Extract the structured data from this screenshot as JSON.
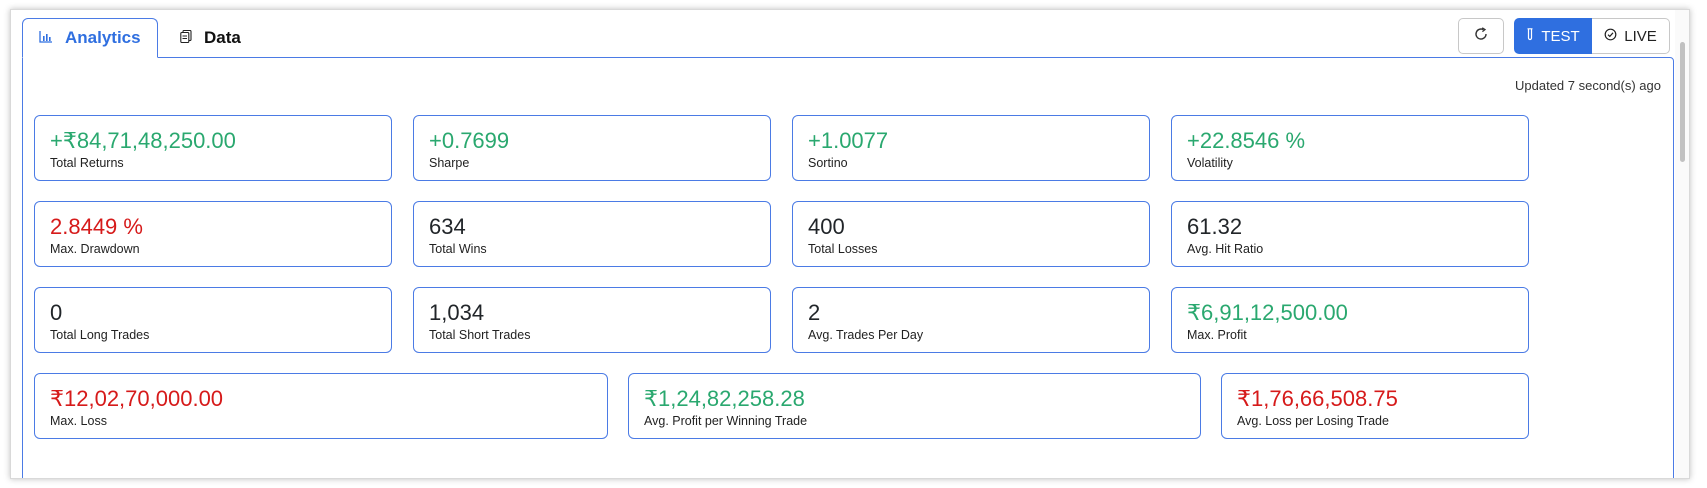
{
  "tabs": [
    {
      "label": "Analytics",
      "icon": "bar-chart-icon",
      "active": true
    },
    {
      "label": "Data",
      "icon": "document-icon",
      "active": false
    }
  ],
  "controls": {
    "refresh_icon": "refresh-icon",
    "test_label": "TEST",
    "live_label": "LIVE",
    "accent": "#2f6fe0"
  },
  "updated_text": "Updated 7 second(s) ago",
  "metrics": [
    {
      "value": "+₹84,71,48,250.00",
      "label": "Total Returns",
      "tone": "green"
    },
    {
      "value": "+0.7699",
      "label": "Sharpe",
      "tone": "green"
    },
    {
      "value": "+1.0077",
      "label": "Sortino",
      "tone": "green"
    },
    {
      "value": "+22.8546 %",
      "label": "Volatility",
      "tone": "green"
    },
    {
      "value": "2.8449 %",
      "label": "Max. Drawdown",
      "tone": "red"
    },
    {
      "value": "634",
      "label": "Total Wins",
      "tone": "dark"
    },
    {
      "value": "400",
      "label": "Total Losses",
      "tone": "dark"
    },
    {
      "value": "61.32",
      "label": "Avg. Hit Ratio",
      "tone": "dark"
    },
    {
      "value": "0",
      "label": "Total Long Trades",
      "tone": "dark"
    },
    {
      "value": "1,034",
      "label": "Total Short Trades",
      "tone": "dark"
    },
    {
      "value": "2",
      "label": "Avg. Trades Per Day",
      "tone": "dark"
    },
    {
      "value": "₹6,91,12,500.00",
      "label": "Max. Profit",
      "tone": "green"
    },
    {
      "value": "₹12,02,70,000.00",
      "label": "Max. Loss",
      "tone": "red"
    },
    {
      "value": "₹1,24,82,258.28",
      "label": "Avg. Profit per Winning Trade",
      "tone": "green"
    },
    {
      "value": "₹1,76,66,508.75",
      "label": "Avg. Loss per Losing Trade",
      "tone": "red"
    }
  ],
  "colors": {
    "positive": "#2aa86f",
    "negative": "#d61a1a",
    "border": "#4b7be5"
  }
}
